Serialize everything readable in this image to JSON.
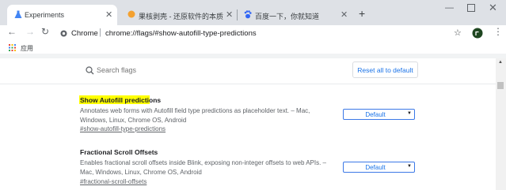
{
  "tabs": [
    {
      "title": "Experiments",
      "icon": "flask-icon",
      "active": true
    },
    {
      "title": "果核剥壳 - 还原软件的本质",
      "icon": "orange-circle-icon",
      "active": false
    },
    {
      "title": "百度一下，你就知道",
      "icon": "paw-icon",
      "active": false
    }
  ],
  "toolbar": {
    "site_label": "Chrome",
    "url": "chrome://flags/#show-autofill-type-predictions"
  },
  "bookmarks": {
    "apps_label": "应用"
  },
  "search": {
    "placeholder": "Search flags",
    "reset_label": "Reset all to default"
  },
  "flags": [
    {
      "title": "Show Autofill predictions",
      "highlighted": true,
      "desc_line1": "Annotates web forms with Autofill field type predictions as placeholder text. – Mac,",
      "desc_line2": "Windows, Linux, Chrome OS, Android",
      "link": "#show-autofill-type-predictions",
      "value": "Default"
    },
    {
      "title": "Fractional Scroll Offsets",
      "highlighted": false,
      "desc_line1": "Enables fractional scroll offsets inside Blink, exposing non-integer offsets to web APIs. –",
      "desc_line2": "Mac, Windows, Linux, Chrome OS, Android",
      "link": "#fractional-scroll-offsets",
      "value": "Default"
    }
  ],
  "colors": {
    "highlight": "#ffff00",
    "accent": "#1a73e8",
    "tabstrip": "#dee1e6"
  }
}
